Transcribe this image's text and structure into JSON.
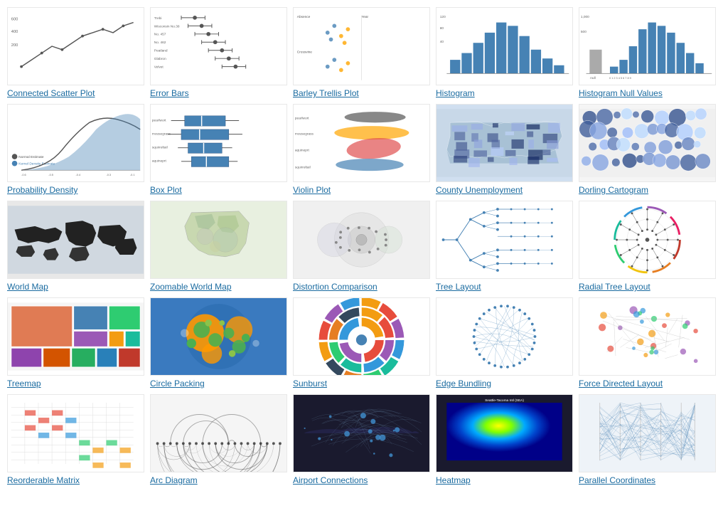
{
  "charts": [
    {
      "id": "connected-scatter",
      "label": "Connected Scatter Plot",
      "thumb_type": "connected-scatter"
    },
    {
      "id": "error-bars",
      "label": "Error Bars",
      "thumb_type": "error-bars"
    },
    {
      "id": "barley-trellis",
      "label": "Barley Trellis Plot",
      "thumb_type": "barley"
    },
    {
      "id": "histogram",
      "label": "Histogram",
      "thumb_type": "histogram"
    },
    {
      "id": "histogram-null",
      "label": "Histogram Null Values",
      "thumb_type": "histogram-null"
    },
    {
      "id": "prob-density",
      "label": "Probability Density",
      "thumb_type": "prob-density"
    },
    {
      "id": "box-plot",
      "label": "Box Plot",
      "thumb_type": "boxplot"
    },
    {
      "id": "violin-plot",
      "label": "Violin Plot",
      "thumb_type": "violin"
    },
    {
      "id": "county-unemployment",
      "label": "County Unemployment",
      "thumb_type": "county"
    },
    {
      "id": "dorling-cartogram",
      "label": "Dorling Cartogram",
      "thumb_type": "dorling"
    },
    {
      "id": "world-map",
      "label": "World Map",
      "thumb_type": "worldmap"
    },
    {
      "id": "zoomable-world-map",
      "label": "Zoomable World Map",
      "thumb_type": "zoomable-world"
    },
    {
      "id": "distortion-comparison",
      "label": "Distortion Comparison",
      "thumb_type": "distortion"
    },
    {
      "id": "tree-layout",
      "label": "Tree Layout",
      "thumb_type": "tree"
    },
    {
      "id": "radial-tree-layout",
      "label": "Radial Tree Layout",
      "thumb_type": "radial-tree"
    },
    {
      "id": "treemap",
      "label": "Treemap",
      "thumb_type": "treemap"
    },
    {
      "id": "circle-packing",
      "label": "Circle Packing",
      "thumb_type": "circle-packing"
    },
    {
      "id": "sunburst",
      "label": "Sunburst",
      "thumb_type": "sunburst"
    },
    {
      "id": "edge-bundling",
      "label": "Edge Bundling",
      "thumb_type": "edge-bundling"
    },
    {
      "id": "force-directed",
      "label": "Force Directed Layout",
      "thumb_type": "force-directed"
    },
    {
      "id": "reorderable-matrix",
      "label": "Reorderable Matrix",
      "thumb_type": "reorderable"
    },
    {
      "id": "arc-diagram",
      "label": "Arc Diagram",
      "thumb_type": "arc-diagram"
    },
    {
      "id": "airport-connections",
      "label": "Airport Connections",
      "thumb_type": "airport"
    },
    {
      "id": "heatmap",
      "label": "Heatmap",
      "thumb_type": "heatmap"
    },
    {
      "id": "parallel-coordinates",
      "label": "Parallel Coordinates",
      "thumb_type": "parallel"
    }
  ]
}
